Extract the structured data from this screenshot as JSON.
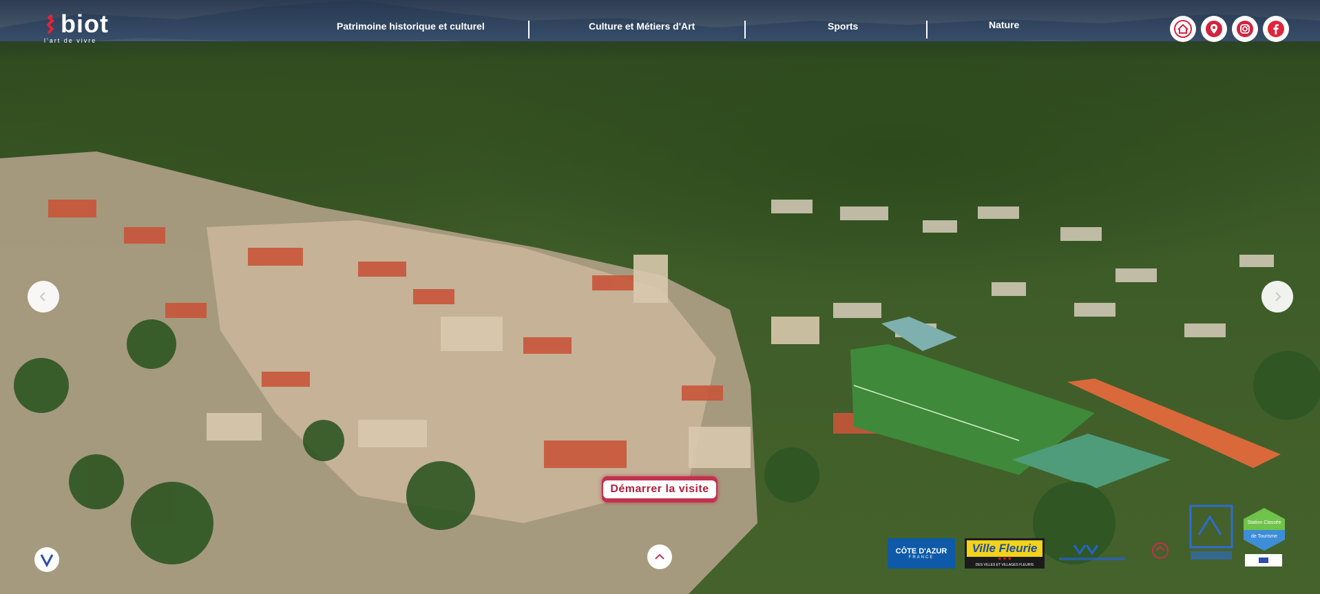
{
  "brand": {
    "name": "biot",
    "tagline": "l'art de vivre"
  },
  "nav": {
    "items": [
      {
        "label": "Patrimoine historique et culturel"
      },
      {
        "label": "Culture et Métiers d'Art"
      },
      {
        "label": "Sports"
      },
      {
        "label": "Nature"
      }
    ]
  },
  "social": [
    {
      "icon": "home-icon"
    },
    {
      "icon": "location-pin-icon"
    },
    {
      "icon": "instagram-icon"
    },
    {
      "icon": "facebook-icon"
    }
  ],
  "carousel": {
    "prev_icon": "chevron-left-icon",
    "next_icon": "chevron-right-icon"
  },
  "cta": {
    "start_label": "Démarrer la visite",
    "scroll_up_icon": "chevron-up-icon"
  },
  "partners": {
    "cote_azur": {
      "title": "CÔTE D'AZUR",
      "subtitle": "FRANCE"
    },
    "ville_fleurie": {
      "label": "Ville Fleurie",
      "stars": "★★★",
      "subtitle": "DES VILLES ET VILLAGES FLEURIS"
    },
    "station_classee": {
      "line1": "Station Classée",
      "line2": "de Tourisme"
    }
  },
  "colors": {
    "accent": "#c0324d",
    "nav_text": "#ffffff",
    "icon_red": "#d2233f",
    "facebook_red": "#e0243b"
  }
}
